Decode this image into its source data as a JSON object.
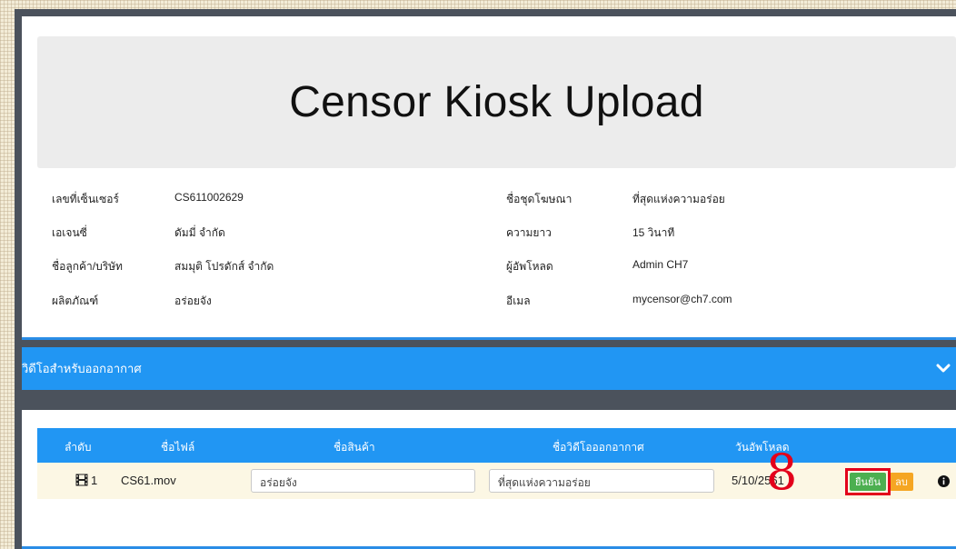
{
  "header": {
    "title": "Censor Kiosk Upload"
  },
  "info_left": [
    {
      "label": "เลขที่เซ็นเซอร์",
      "value": "CS611002629"
    },
    {
      "label": "เอเจนซี่",
      "value": "ดัมมี่ จำกัด"
    },
    {
      "label": "ชื่อลูกค้า/บริษัท",
      "value": "สมมุติ โปรดักส์ จำกัด"
    },
    {
      "label": "ผลิตภัณฑ์",
      "value": "อร่อยจัง"
    }
  ],
  "info_right": [
    {
      "label": "ชื่อชุดโฆษณา",
      "value": "ที่สุดแห่งความอร่อย"
    },
    {
      "label": "ความยาว",
      "value": "15 วินาที"
    },
    {
      "label": "ผู้อัพโหลด",
      "value": "Admin CH7"
    },
    {
      "label": "อีเมล",
      "value": "mycensor@ch7.com"
    }
  ],
  "section": {
    "title": "วิดีโอสำหรับออกอากาศ",
    "icon": "chevron-down-icon"
  },
  "table": {
    "headers": [
      "ลำดับ",
      "ชื่อไฟล์",
      "ชื่อสินค้า",
      "ชื่อวิดีโอออกอากาศ",
      "วันอัพโหลด"
    ],
    "rows": [
      {
        "index": "1",
        "filename": "CS61.mov",
        "product": "อร่อยจัง",
        "video_name": "ที่สุดแห่งความอร่อย",
        "upload_date": "5/10/2561",
        "confirm_label": "ยืนยัน",
        "delete_label": "ลบ"
      }
    ]
  },
  "annotation": {
    "step": "8",
    "color": "#e3001b"
  },
  "colors": {
    "primary": "#2196f3",
    "confirm": "#4caf50",
    "delete": "#f5a623"
  }
}
